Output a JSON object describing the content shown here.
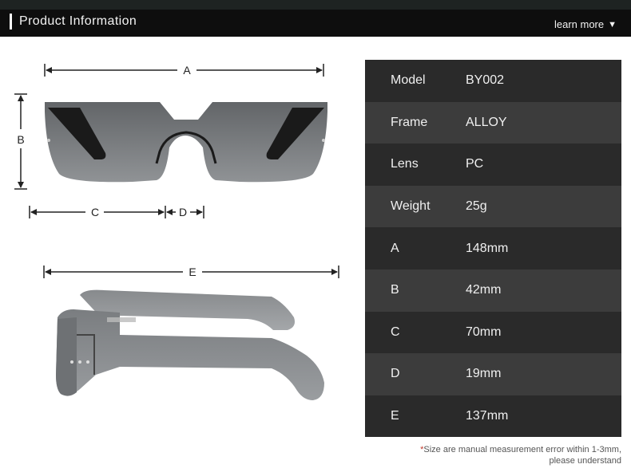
{
  "header": {
    "title": "Product Information",
    "learn_more": "learn more",
    "learn_more_icon": "triangle-down-icon"
  },
  "dimensions": {
    "a": "A",
    "b": "B",
    "c": "C",
    "d": "D",
    "e": "E"
  },
  "specs": [
    {
      "label": "Model",
      "value": "BY002"
    },
    {
      "label": "Frame",
      "value": "ALLOY"
    },
    {
      "label": "Lens",
      "value": "PC"
    },
    {
      "label": "Weight",
      "value": "25g"
    },
    {
      "label": "A",
      "value": "148mm"
    },
    {
      "label": "B",
      "value": "42mm"
    },
    {
      "label": "C",
      "value": "70mm"
    },
    {
      "label": "D",
      "value": "19mm"
    },
    {
      "label": "E",
      "value": "137mm"
    }
  ],
  "note": {
    "asterisk": "*",
    "line1": "Size are manual measurement error within 1-3mm,",
    "line2": "please understand"
  },
  "colors": {
    "header_bg": "#0e0e0e",
    "row_dark": "#2a2a2a",
    "row_light": "#3c3c3c",
    "note_accent": "#c0392b"
  }
}
